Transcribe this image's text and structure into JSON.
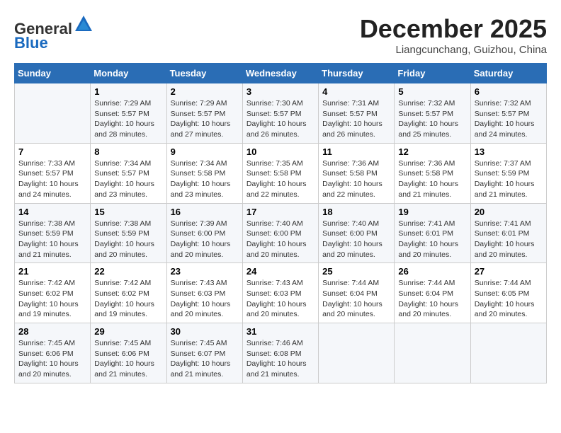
{
  "logo": {
    "general": "General",
    "blue": "Blue"
  },
  "header": {
    "month": "December 2025",
    "location": "Liangcunchang, Guizhou, China"
  },
  "weekdays": [
    "Sunday",
    "Monday",
    "Tuesday",
    "Wednesday",
    "Thursday",
    "Friday",
    "Saturday"
  ],
  "weeks": [
    [
      {
        "day": "",
        "info": ""
      },
      {
        "day": "1",
        "info": "Sunrise: 7:29 AM\nSunset: 5:57 PM\nDaylight: 10 hours\nand 28 minutes."
      },
      {
        "day": "2",
        "info": "Sunrise: 7:29 AM\nSunset: 5:57 PM\nDaylight: 10 hours\nand 27 minutes."
      },
      {
        "day": "3",
        "info": "Sunrise: 7:30 AM\nSunset: 5:57 PM\nDaylight: 10 hours\nand 26 minutes."
      },
      {
        "day": "4",
        "info": "Sunrise: 7:31 AM\nSunset: 5:57 PM\nDaylight: 10 hours\nand 26 minutes."
      },
      {
        "day": "5",
        "info": "Sunrise: 7:32 AM\nSunset: 5:57 PM\nDaylight: 10 hours\nand 25 minutes."
      },
      {
        "day": "6",
        "info": "Sunrise: 7:32 AM\nSunset: 5:57 PM\nDaylight: 10 hours\nand 24 minutes."
      }
    ],
    [
      {
        "day": "7",
        "info": "Sunrise: 7:33 AM\nSunset: 5:57 PM\nDaylight: 10 hours\nand 24 minutes."
      },
      {
        "day": "8",
        "info": "Sunrise: 7:34 AM\nSunset: 5:57 PM\nDaylight: 10 hours\nand 23 minutes."
      },
      {
        "day": "9",
        "info": "Sunrise: 7:34 AM\nSunset: 5:58 PM\nDaylight: 10 hours\nand 23 minutes."
      },
      {
        "day": "10",
        "info": "Sunrise: 7:35 AM\nSunset: 5:58 PM\nDaylight: 10 hours\nand 22 minutes."
      },
      {
        "day": "11",
        "info": "Sunrise: 7:36 AM\nSunset: 5:58 PM\nDaylight: 10 hours\nand 22 minutes."
      },
      {
        "day": "12",
        "info": "Sunrise: 7:36 AM\nSunset: 5:58 PM\nDaylight: 10 hours\nand 21 minutes."
      },
      {
        "day": "13",
        "info": "Sunrise: 7:37 AM\nSunset: 5:59 PM\nDaylight: 10 hours\nand 21 minutes."
      }
    ],
    [
      {
        "day": "14",
        "info": "Sunrise: 7:38 AM\nSunset: 5:59 PM\nDaylight: 10 hours\nand 21 minutes."
      },
      {
        "day": "15",
        "info": "Sunrise: 7:38 AM\nSunset: 5:59 PM\nDaylight: 10 hours\nand 20 minutes."
      },
      {
        "day": "16",
        "info": "Sunrise: 7:39 AM\nSunset: 6:00 PM\nDaylight: 10 hours\nand 20 minutes."
      },
      {
        "day": "17",
        "info": "Sunrise: 7:40 AM\nSunset: 6:00 PM\nDaylight: 10 hours\nand 20 minutes."
      },
      {
        "day": "18",
        "info": "Sunrise: 7:40 AM\nSunset: 6:00 PM\nDaylight: 10 hours\nand 20 minutes."
      },
      {
        "day": "19",
        "info": "Sunrise: 7:41 AM\nSunset: 6:01 PM\nDaylight: 10 hours\nand 20 minutes."
      },
      {
        "day": "20",
        "info": "Sunrise: 7:41 AM\nSunset: 6:01 PM\nDaylight: 10 hours\nand 20 minutes."
      }
    ],
    [
      {
        "day": "21",
        "info": "Sunrise: 7:42 AM\nSunset: 6:02 PM\nDaylight: 10 hours\nand 19 minutes."
      },
      {
        "day": "22",
        "info": "Sunrise: 7:42 AM\nSunset: 6:02 PM\nDaylight: 10 hours\nand 19 minutes."
      },
      {
        "day": "23",
        "info": "Sunrise: 7:43 AM\nSunset: 6:03 PM\nDaylight: 10 hours\nand 20 minutes."
      },
      {
        "day": "24",
        "info": "Sunrise: 7:43 AM\nSunset: 6:03 PM\nDaylight: 10 hours\nand 20 minutes."
      },
      {
        "day": "25",
        "info": "Sunrise: 7:44 AM\nSunset: 6:04 PM\nDaylight: 10 hours\nand 20 minutes."
      },
      {
        "day": "26",
        "info": "Sunrise: 7:44 AM\nSunset: 6:04 PM\nDaylight: 10 hours\nand 20 minutes."
      },
      {
        "day": "27",
        "info": "Sunrise: 7:44 AM\nSunset: 6:05 PM\nDaylight: 10 hours\nand 20 minutes."
      }
    ],
    [
      {
        "day": "28",
        "info": "Sunrise: 7:45 AM\nSunset: 6:06 PM\nDaylight: 10 hours\nand 20 minutes."
      },
      {
        "day": "29",
        "info": "Sunrise: 7:45 AM\nSunset: 6:06 PM\nDaylight: 10 hours\nand 21 minutes."
      },
      {
        "day": "30",
        "info": "Sunrise: 7:45 AM\nSunset: 6:07 PM\nDaylight: 10 hours\nand 21 minutes."
      },
      {
        "day": "31",
        "info": "Sunrise: 7:46 AM\nSunset: 6:08 PM\nDaylight: 10 hours\nand 21 minutes."
      },
      {
        "day": "",
        "info": ""
      },
      {
        "day": "",
        "info": ""
      },
      {
        "day": "",
        "info": ""
      }
    ]
  ]
}
